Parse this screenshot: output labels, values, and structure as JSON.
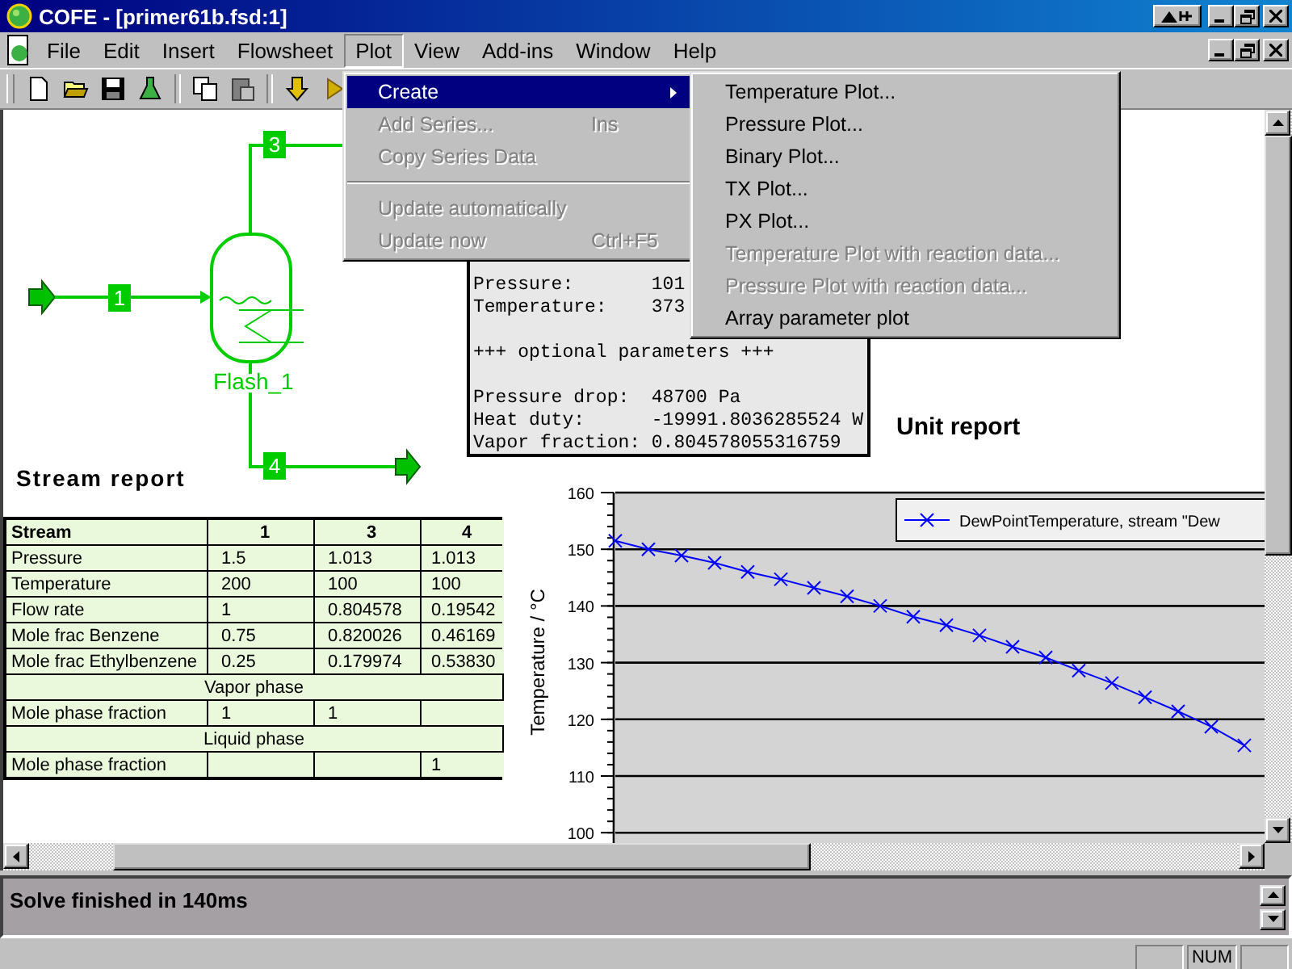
{
  "window": {
    "title": "COFE - [primer61b.fsd:1]"
  },
  "menubar": [
    {
      "label": "File",
      "selected": false
    },
    {
      "label": "Edit",
      "selected": false
    },
    {
      "label": "Insert",
      "selected": false
    },
    {
      "label": "Flowsheet",
      "selected": false
    },
    {
      "label": "Plot",
      "selected": true
    },
    {
      "label": "View",
      "selected": false
    },
    {
      "label": "Add-ins",
      "selected": false
    },
    {
      "label": "Window",
      "selected": false
    },
    {
      "label": "Help",
      "selected": false
    }
  ],
  "plot_menu": [
    {
      "kind": "item",
      "label": "Create",
      "selected": true,
      "disabled": false,
      "submenu": true
    },
    {
      "kind": "item",
      "label": "Add Series...",
      "shortcut": "Ins",
      "selected": false,
      "disabled": true,
      "submenu": false
    },
    {
      "kind": "item",
      "label": "Copy Series Data",
      "selected": false,
      "disabled": true,
      "submenu": false
    },
    {
      "kind": "separator"
    },
    {
      "kind": "item",
      "label": "Update automatically",
      "selected": false,
      "disabled": true,
      "submenu": false
    },
    {
      "kind": "item",
      "label": "Update now",
      "shortcut": "Ctrl+F5",
      "selected": false,
      "disabled": true,
      "submenu": false
    }
  ],
  "create_submenu": [
    {
      "label": "Temperature Plot...",
      "disabled": false
    },
    {
      "label": "Pressure Plot...",
      "disabled": false
    },
    {
      "label": "Binary Plot...",
      "disabled": false
    },
    {
      "label": "TX Plot...",
      "disabled": false
    },
    {
      "label": "PX Plot...",
      "disabled": false
    },
    {
      "label": "Temperature Plot with reaction data...",
      "disabled": true
    },
    {
      "label": "Pressure Plot with reaction data...",
      "disabled": true
    },
    {
      "label": "Array parameter plot",
      "disabled": false
    }
  ],
  "flowsheet": {
    "unit": "Flash_1",
    "streams": [
      {
        "label": "1"
      },
      {
        "label": "3"
      },
      {
        "label": "4"
      }
    ]
  },
  "unit_report": {
    "title": "Unit report",
    "sections": [
      [
        {
          "label": "Pressure:",
          "value": "101"
        },
        {
          "label": "Temperature:",
          "value": "373"
        }
      ],
      [
        {
          "label": "+++ optional parameters +++"
        }
      ],
      [
        {
          "label": "Pressure drop:",
          "value": "48700 Pa"
        },
        {
          "label": "Heat duty:",
          "value": "-19991.8036285524 W"
        },
        {
          "label": "Vapor fraction:",
          "value": "0.804578055316759"
        }
      ]
    ]
  },
  "stream_report": {
    "title": "Stream report",
    "columns": [
      "Stream",
      "1",
      "3",
      "4"
    ],
    "rows": [
      {
        "kind": "data",
        "cells": [
          "Pressure",
          "1.5",
          "1.013",
          "1.013"
        ]
      },
      {
        "kind": "data",
        "cells": [
          "Temperature",
          "200",
          "100",
          "100"
        ]
      },
      {
        "kind": "data",
        "cells": [
          "Flow rate",
          "1",
          "0.804578",
          "0.19542"
        ]
      },
      {
        "kind": "data",
        "cells": [
          "Mole frac Benzene",
          "0.75",
          "0.820026",
          "0.46169"
        ]
      },
      {
        "kind": "data",
        "cells": [
          "Mole frac Ethylbenzene",
          "0.25",
          "0.179974",
          "0.53830"
        ]
      },
      {
        "kind": "section",
        "title": "Vapor phase"
      },
      {
        "kind": "data",
        "cells": [
          "Mole phase fraction",
          "1",
          "1",
          null
        ]
      },
      {
        "kind": "section",
        "title": "Liquid phase"
      },
      {
        "kind": "data",
        "cells": [
          "Mole phase fraction",
          null,
          null,
          "1"
        ]
      }
    ]
  },
  "plot": {
    "chart_data": {
      "type": "line",
      "grid": true,
      "ylabel": "Temperature / °C",
      "ylim": [
        100,
        160
      ],
      "yticks": [
        100,
        110,
        120,
        130,
        140,
        150,
        160
      ],
      "series": [
        {
          "name": "DewPointTemperature, stream \"Dew",
          "color": "#0000ff",
          "marker": "x",
          "values": [
            151.5,
            150.0,
            148.9,
            147.6,
            146.0,
            144.7,
            143.2,
            141.7,
            140.0,
            138.1,
            136.6,
            134.8,
            132.8,
            130.9,
            128.6,
            126.4,
            123.9,
            121.4,
            118.7,
            115.4
          ]
        }
      ]
    }
  },
  "log": {
    "lines": [
      "Solve finished in 140ms"
    ]
  },
  "status_bar": {
    "panes": [
      "NUM"
    ]
  }
}
